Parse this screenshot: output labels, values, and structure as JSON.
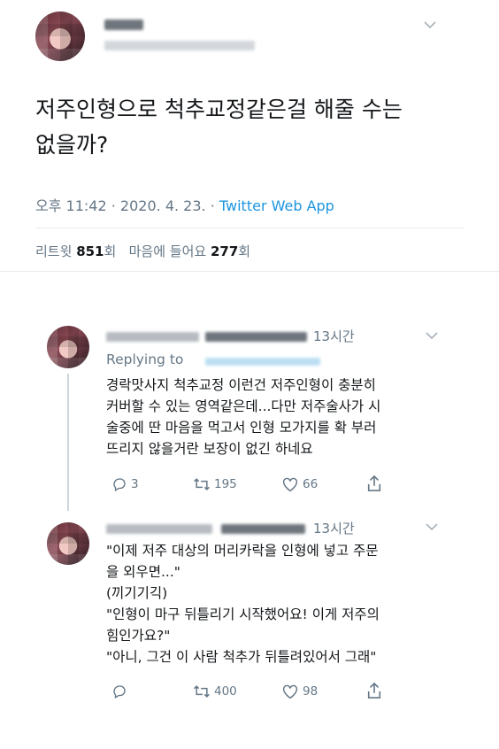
{
  "main_tweet": {
    "text_line1": "저주인형으로 척추교정같은걸 해줄 수는",
    "text_line2": "없을까?",
    "time": "오후 11:42",
    "sep": "·",
    "date": "2020. 4. 23.",
    "source": "Twitter Web App",
    "retweets_label": "리트윗",
    "retweets_count": "851",
    "retweets_unit": "회",
    "likes_label": "마음에 들어요",
    "likes_count": "277",
    "likes_unit": "회"
  },
  "reply1": {
    "time": "13시간",
    "replying_to": "Replying to",
    "text": "경락맛사지 척추교정 이런건 저주인형이 충분히\n커버할 수 있는 영역같은데...다만 저주술사가 시\n술중에 딴 마음을 먹고서 인형 모가지를 확 부러\n뜨리지 않을거란 보장이 없긴 하네요",
    "replies": "3",
    "retweets": "195",
    "likes": "66"
  },
  "reply2": {
    "time": "13시간",
    "text": "\"이제 저주 대상의 머리카락을 인형에 넣고 주문\n을 외우면...\"\n(끼기기긱)\n\"인형이 마구 뒤틀리기 시작했어요! 이게 저주의\n힘인가요?\"\n\"아니, 그건 이 사람 척추가 뒤틀려있어서 그래\"",
    "retweets": "400",
    "likes": "98"
  },
  "icons": {
    "chevron": "chevron-down-icon",
    "reply": "reply-icon",
    "retweet": "retweet-icon",
    "like": "heart-icon",
    "share": "share-icon"
  },
  "colors": {
    "link": "#1b95e0",
    "secondary": "#657786",
    "text": "#14171a",
    "divider": "#e6ecf0"
  }
}
